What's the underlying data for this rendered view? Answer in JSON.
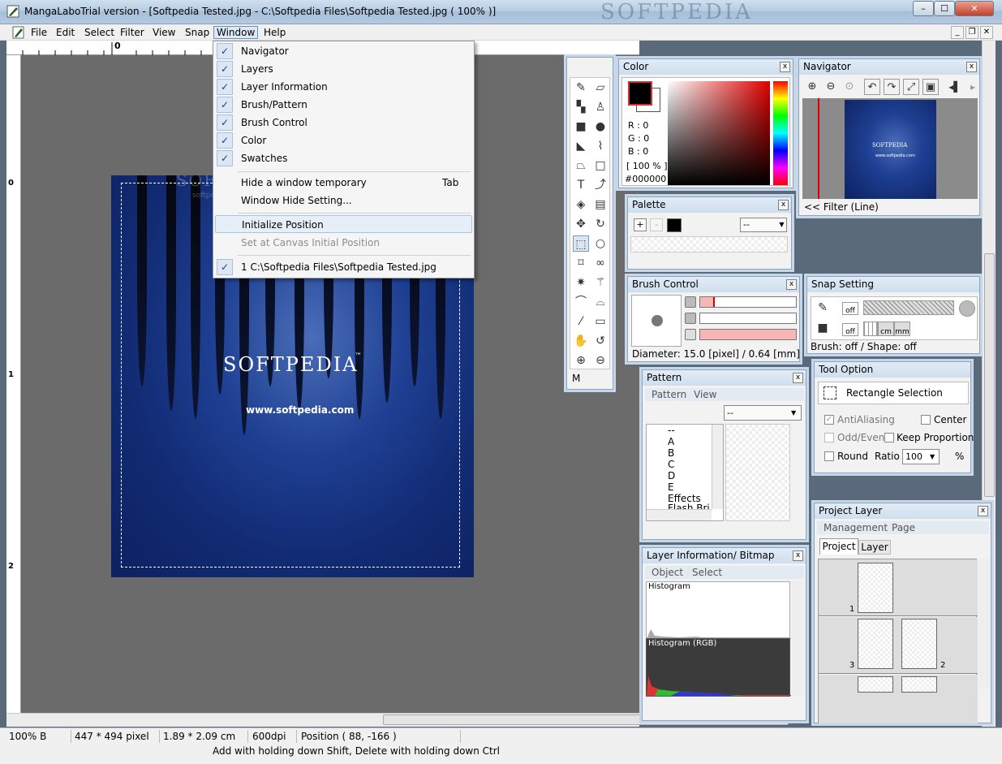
{
  "window": {
    "title": "MangaLaboTrial version - [Softpedia Tested.jpg - C:\\Softpedia Files\\Softpedia Tested.jpg ( 100% )]",
    "watermark": "SOFTPEDIA",
    "min": "–",
    "max": "☐",
    "close": "✕"
  },
  "menubar": {
    "items": [
      "File",
      "Edit",
      "Select",
      "Filter",
      "View",
      "Snap",
      "Window",
      "Help"
    ],
    "mdi_min": "_",
    "mdi_restore": "❐",
    "mdi_close": "✕"
  },
  "rulers": {
    "top_zero": "0",
    "left_marks": [
      "0",
      "1",
      "2"
    ]
  },
  "document": {
    "logo": "SOFTPEDIA",
    "tm": "™",
    "url": "www.softpedia.com",
    "watermark": "SOFTPEDIA",
    "watermark2": "softpedia"
  },
  "window_menu": {
    "checked_items": [
      "Navigator",
      "Layers",
      "Layer Information",
      "Brush/Pattern",
      "Brush Control",
      "Color",
      "Swatches"
    ],
    "check_glyph": "✓",
    "hide_temporary": "Hide a window temporary",
    "hide_temporary_accel": "Tab",
    "hide_setting": "Window Hide Setting...",
    "initialize": "Initialize Position",
    "set_canvas": "Set at Canvas Initial Position",
    "recent": "1 C:\\Softpedia Files\\Softpedia Tested.jpg"
  },
  "tools": {
    "mode_label": "M"
  },
  "color": {
    "title": "Color",
    "r": "R : 0",
    "g": "G : 0",
    "b": "B : 0",
    "pct": "[ 100 % ]",
    "hex": "#000000",
    "fg": "#000000",
    "bg": "#ffffff"
  },
  "navigator": {
    "title": "Navigator",
    "thumb_text": "SOFTPEDIA",
    "thumb_url": "www.softpedia.com",
    "filter": "<< Filter (Line)"
  },
  "palette": {
    "title": "Palette",
    "add": "+",
    "remove": "-",
    "dropdown": "--"
  },
  "brush_control": {
    "title": "Brush Control",
    "diameter": "Diameter: 15.0 [pixel] / 0.64 [mm]"
  },
  "snap": {
    "title": "Snap Setting",
    "off1": "off",
    "off2": "off",
    "cm": "cm",
    "mm": "mm",
    "status": "Brush: off / Shape: off"
  },
  "pattern": {
    "title": "Pattern",
    "tabs": [
      "Pattern",
      "View"
    ],
    "dropdown": "--",
    "tree": [
      "--",
      "A",
      "B",
      "C",
      "D",
      "E",
      "Effects",
      "Flash Bri..."
    ]
  },
  "tool_option": {
    "title": "Tool Option",
    "tool_name": "Rectangle Selection",
    "antialiasing": "AntiAliasing",
    "center": "Center",
    "odd_even": "Odd/Even",
    "keep_prop": "Keep Proportion",
    "round": "Round",
    "ratio_label": "Ratio",
    "ratio_value": "100",
    "pct": "%"
  },
  "layer_info": {
    "title": "Layer Information/ Bitmap",
    "tabs": [
      "Object",
      "Select"
    ],
    "hist": "Histogram",
    "hist_rgb": "Histogram (RGB)"
  },
  "project_layer": {
    "title": "Project Layer",
    "menu": [
      "Management",
      "Page"
    ],
    "tabs": [
      "Project",
      "Layer"
    ],
    "page_nums": [
      "1",
      "3",
      "2"
    ]
  },
  "status": {
    "zoom": "100% B",
    "size_px": "447 * 494 pixel",
    "size_cm": "1.89 * 2.09 cm",
    "dpi": "600dpi",
    "position": "Position ( 88, -166 )",
    "hint": "Add with holding down Shift, Delete with holding down Ctrl"
  }
}
